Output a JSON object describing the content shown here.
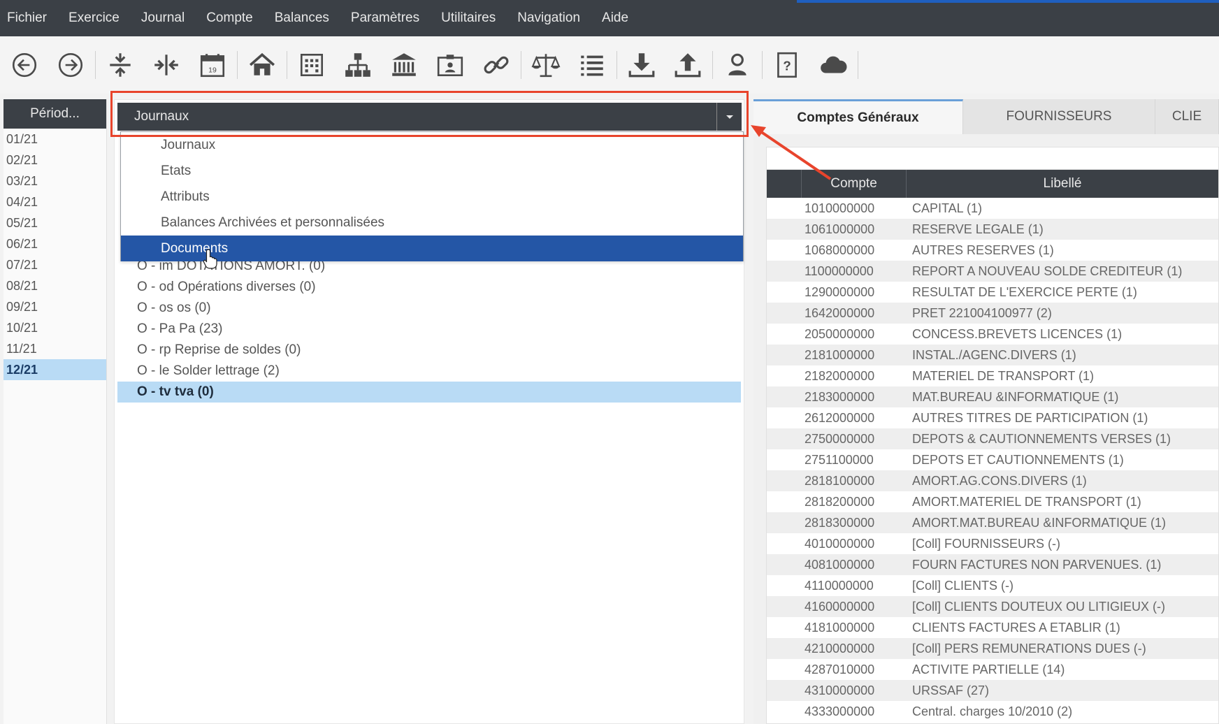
{
  "menubar": {
    "items": [
      "Fichier",
      "Exercice",
      "Journal",
      "Compte",
      "Balances",
      "Paramètres",
      "Utilitaires",
      "Navigation",
      "Aide"
    ]
  },
  "toolbar": {
    "icons": [
      "back-icon",
      "forward-icon",
      "collapse-vertical-icon",
      "collapse-horizontal-icon",
      "calendar-icon",
      "home-icon",
      "building-icon",
      "org-chart-icon",
      "bank-icon",
      "contact-card-icon",
      "link-icon",
      "balance-scale-icon",
      "list-icon",
      "download-icon",
      "upload-icon",
      "user-icon",
      "help-icon",
      "cloud-icon"
    ]
  },
  "period": {
    "header": "Périod...",
    "items": [
      "01/21",
      "02/21",
      "03/21",
      "04/21",
      "05/21",
      "06/21",
      "07/21",
      "08/21",
      "09/21",
      "10/21",
      "11/21",
      "12/21"
    ],
    "selected": "12/21"
  },
  "journal_select": {
    "value": "Journaux",
    "options": [
      "Journaux",
      "Etats",
      "Attributs",
      "Balances Archivées et personnalisées",
      "Documents"
    ],
    "highlighted": "Documents"
  },
  "journals": {
    "items": [
      "O - im DOTATIONS AMORT. (0)",
      "O - od Opérations diverses (0)",
      "O - os os (0)",
      "O - Pa Pa (23)",
      "O - rp Reprise de soldes (0)",
      "O - le Solder lettrage (2)",
      "O - tv tva (0)"
    ],
    "selected": "O - tv tva (0)"
  },
  "tabs": [
    "Comptes Généraux",
    "FOURNISSEURS",
    "CLIE"
  ],
  "grid": {
    "headers": {
      "compte": "Compte",
      "libelle": "Libellé"
    },
    "rows": [
      {
        "compte": "1010000000",
        "libelle": "CAPITAL (1)"
      },
      {
        "compte": "1061000000",
        "libelle": "RESERVE LEGALE (1)"
      },
      {
        "compte": "1068000000",
        "libelle": "AUTRES RESERVES (1)"
      },
      {
        "compte": "1100000000",
        "libelle": "REPORT A NOUVEAU SOLDE CREDITEUR (1)"
      },
      {
        "compte": "1290000000",
        "libelle": "RESULTAT DE L'EXERCICE PERTE (1)"
      },
      {
        "compte": "1642000000",
        "libelle": "PRET 221004100977 (2)"
      },
      {
        "compte": "2050000000",
        "libelle": "CONCESS.BREVETS LICENCES (1)"
      },
      {
        "compte": "2181000000",
        "libelle": "INSTAL./AGENC.DIVERS (1)"
      },
      {
        "compte": "2182000000",
        "libelle": "MATERIEL DE TRANSPORT (1)"
      },
      {
        "compte": "2183000000",
        "libelle": "MAT.BUREAU &INFORMATIQUE (1)"
      },
      {
        "compte": "2612000000",
        "libelle": "AUTRES TITRES DE PARTICIPATION (1)"
      },
      {
        "compte": "2750000000",
        "libelle": "DEPOTS & CAUTIONNEMENTS VERSES (1)"
      },
      {
        "compte": "2751100000",
        "libelle": "DEPOTS ET CAUTIONNEMENTS (1)"
      },
      {
        "compte": "2818100000",
        "libelle": "AMORT.AG.CONS.DIVERS (1)"
      },
      {
        "compte": "2818200000",
        "libelle": "AMORT.MATERIEL DE TRANSPORT (1)"
      },
      {
        "compte": "2818300000",
        "libelle": "AMORT.MAT.BUREAU &INFORMATIQUE (1)"
      },
      {
        "compte": "4010000000",
        "libelle": "[Coll] FOURNISSEURS (-)"
      },
      {
        "compte": "4081000000",
        "libelle": "FOURN FACTURES NON PARVENUES. (1)"
      },
      {
        "compte": "4110000000",
        "libelle": "[Coll] CLIENTS (-)"
      },
      {
        "compte": "4160000000",
        "libelle": "[Coll] CLIENTS DOUTEUX OU LITIGIEUX (-)"
      },
      {
        "compte": "4181000000",
        "libelle": "CLIENTS FACTURES A ETABLIR (1)"
      },
      {
        "compte": "4210000000",
        "libelle": "[Coll] PERS REMUNERATIONS DUES (-)"
      },
      {
        "compte": "4287010000",
        "libelle": "ACTIVITE PARTIELLE (14)"
      },
      {
        "compte": "4310000000",
        "libelle": "URSSAF (27)"
      },
      {
        "compte": "4333000000",
        "libelle": "Central. charges 10/2010 (2)"
      }
    ]
  },
  "colors": {
    "dark_bar": "#3b4046",
    "selection": "#b9dbf5",
    "highlight_blue": "#2456a6",
    "annotation_red": "#e8442c"
  }
}
